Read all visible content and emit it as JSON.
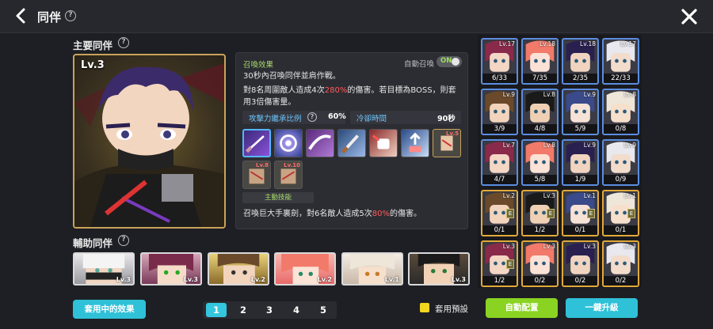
{
  "header": {
    "title": "同伴"
  },
  "main": {
    "section_title": "主要同伴",
    "level": "Lv.3"
  },
  "summon_panel": {
    "heading": "召喚效果",
    "auto_label": "自動召喚",
    "toggle_label": "ON",
    "line1": "30秒內召喚同伴並肩作戰。",
    "line2_a": "對8名周圍敵人造成4次",
    "line2_pct": "280%",
    "line2_b": "的傷害。若目標為BOSS，則套用3倍傷害量。",
    "stat1_label": "攻擊力繼承比例",
    "stat1_value": "60%",
    "stat2_label": "冷卻時間",
    "stat2_value": "90秒",
    "skill_lv_a": "Lv.5",
    "skill_lv_b": "Lv.8",
    "skill_lv_c": "Lv.10",
    "active_skill_label": "主動技能",
    "active_a": "召喚巨大手裏劍，對6名敵人造成5次",
    "active_pct": "80%",
    "active_b": "的傷害。"
  },
  "support": {
    "section_title": "輔助同伴",
    "items": [
      {
        "level": "Lv.3"
      },
      {
        "level": "Lv.3"
      },
      {
        "level": "Lv.2"
      },
      {
        "level": "Lv.2"
      },
      {
        "level": "Lv.1"
      },
      {
        "level": "Lv.3"
      }
    ]
  },
  "footer": {
    "effect_button": "套用中的效果",
    "pages": [
      "1",
      "2",
      "3",
      "4",
      "5"
    ],
    "active_page": "1",
    "preset_label": "套用預設",
    "auto_button": "自動配置",
    "upgrade_button": "一鍵升級"
  },
  "roster": {
    "cells": [
      {
        "level": "Lv.17",
        "count": "6/33"
      },
      {
        "level": "Lv.18",
        "count": "7/35"
      },
      {
        "level": "Lv.18",
        "count": "2/35"
      },
      {
        "level": "Lv.17",
        "count": "22/33"
      },
      {
        "level": "Lv.9",
        "count": "3/9"
      },
      {
        "level": "Lv.8",
        "count": "4/8"
      },
      {
        "level": "Lv.9",
        "count": "5/9"
      },
      {
        "level": "Lv.8",
        "count": "0/8"
      },
      {
        "level": "Lv.7",
        "count": "4/7"
      },
      {
        "level": "Lv.8",
        "count": "5/8"
      },
      {
        "level": "Lv.9",
        "count": "1/9"
      },
      {
        "level": "Lv.9",
        "count": "0/9"
      },
      {
        "level": "Lv.2",
        "count": "0/1"
      },
      {
        "level": "Lv.3",
        "count": "1/2"
      },
      {
        "level": "Lv.1",
        "count": "0/1"
      },
      {
        "level": "Lv.1",
        "count": "0/1"
      },
      {
        "level": "Lv.3",
        "count": "1/2"
      },
      {
        "level": "Lv.3",
        "count": "0/2"
      },
      {
        "level": "Lv.3",
        "count": "0/2"
      },
      {
        "level": "Lv.3",
        "count": "0/2"
      }
    ]
  }
}
